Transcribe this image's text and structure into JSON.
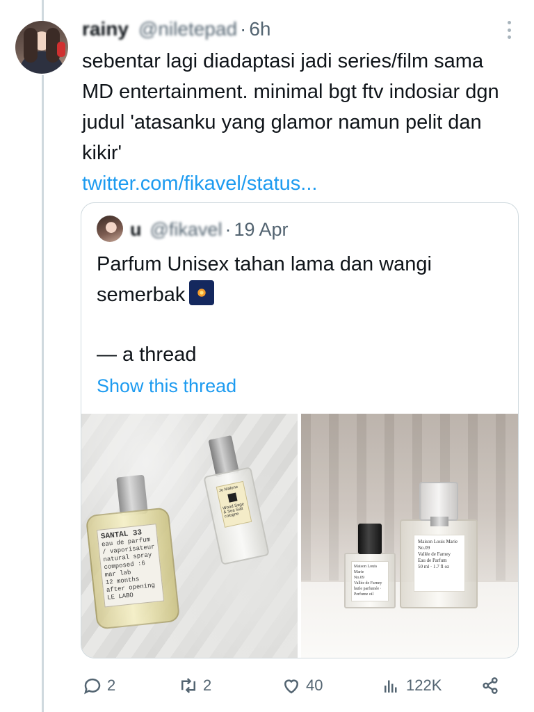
{
  "tweet": {
    "author_name": "rainy",
    "author_handle": "@niletepad",
    "dot": "·",
    "time": "6h",
    "text": "sebentar lagi diadaptasi jadi series/film sama MD entertainment. minimal bgt ftv indosiar dgn judul 'atasanku yang glamor namun pelit dan kikir'",
    "link": "twitter.com/fikavel/status..."
  },
  "quote": {
    "author_name": "u",
    "author_handle": "@fikavel",
    "dot": "·",
    "date": "19 Apr",
    "text": "Parfum Unisex tahan lama dan wangi semerbak",
    "emoji": "fireworks-emoji",
    "thread_label": "— a thread",
    "show_thread": "Show this thread",
    "photos": {
      "left": {
        "santal_name": "SANTAL 33",
        "santal_lines": [
          "eau de parfum / vaporisateur",
          "natural spray",
          "composed :6 mar lab",
          "12 months after opening",
          "LE LABO"
        ],
        "jomalone_brand": "Jo Malone",
        "jomalone_lines": [
          "Wood Sage",
          "& Sea Salt",
          "cologne"
        ]
      },
      "right": {
        "small_label": [
          "Maison Louis Marie",
          "No.09",
          "Vallée de Farney",
          "",
          "huile parfumée · Perfume oil"
        ],
        "big_label": [
          "Maison Louis Marie",
          "No.09",
          "Vallée de Farney",
          "",
          "Eau de Parfum",
          "50 ml · 1.7 fl oz"
        ]
      }
    }
  },
  "actions": {
    "replies": "2",
    "retweets": "2",
    "likes": "40",
    "views": "122K"
  },
  "colors": {
    "link": "#1d9bf0",
    "text": "#0f1419",
    "secondary": "#536471",
    "border": "#cfd9de"
  }
}
